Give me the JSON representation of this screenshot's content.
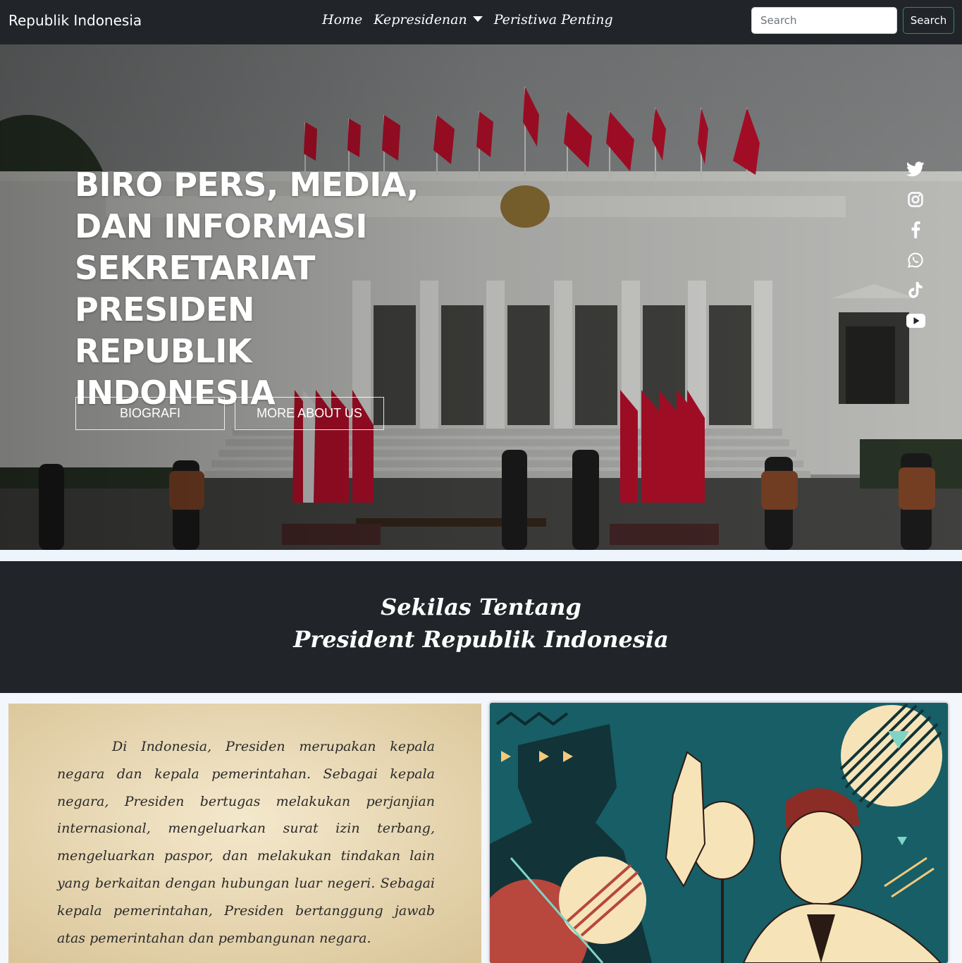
{
  "navbar": {
    "brand": "Republik Indonesia",
    "links": [
      "Home",
      "Kepresidenan",
      "Peristiwa Penting"
    ],
    "search_placeholder": "Search",
    "search_button": "Search"
  },
  "hero": {
    "title": "BIRO PERS, MEDIA, DAN INFORMASI SEKRETARIAT PRESIDEN REPUBLIK INDONESIA",
    "buttons": [
      "BIOGRAFI",
      "MORE ABOUT US"
    ],
    "social_icons": [
      "twitter-icon",
      "instagram-icon",
      "facebook-icon",
      "whatsapp-icon",
      "tiktok-icon",
      "youtube-icon"
    ]
  },
  "sekilas": {
    "line1": "Sekilas Tentang",
    "line2": "President Republik Indonesia"
  },
  "about": {
    "paragraph": "Di Indonesia, Presiden merupakan kepala negara dan kepala pemerintahan. Sebagai kepala negara, Presiden bertugas melakukan perjanjian internasional, mengeluarkan surat izin terbang, mengeluarkan paspor, dan melakukan tindakan lain yang berkaitan dengan hubungan luar negeri. Sebagai kepala pemerintahan, Presiden bertanggung jawab atas pemerintahan dan pembangunan negara."
  },
  "colors": {
    "navbar_bg": "#212529",
    "search_border": "#2e8b57",
    "flag_red": "#c8102e",
    "paper": "#efe0bf",
    "art_teal": "#1b6b74"
  }
}
